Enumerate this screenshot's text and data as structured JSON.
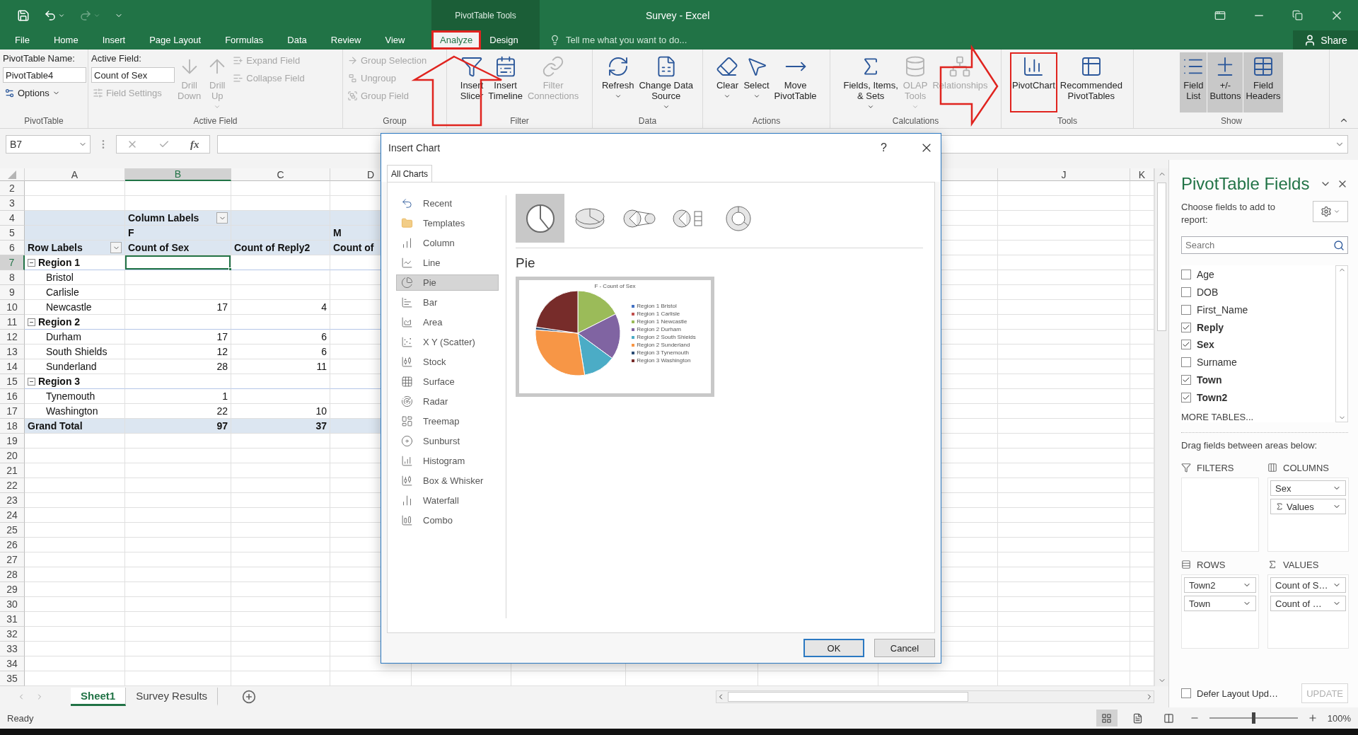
{
  "title_bar": {
    "contextual_label": "PivotTable Tools",
    "title": "Survey - Excel"
  },
  "tabs": [
    {
      "label": "File",
      "selected": false,
      "contextual": false,
      "highlighted": false
    },
    {
      "label": "Home",
      "selected": false,
      "contextual": false,
      "highlighted": false
    },
    {
      "label": "Insert",
      "selected": false,
      "contextual": false,
      "highlighted": false
    },
    {
      "label": "Page Layout",
      "selected": false,
      "contextual": false,
      "highlighted": false
    },
    {
      "label": "Formulas",
      "selected": false,
      "contextual": false,
      "highlighted": false
    },
    {
      "label": "Data",
      "selected": false,
      "contextual": false,
      "highlighted": false
    },
    {
      "label": "Review",
      "selected": false,
      "contextual": false,
      "highlighted": false
    },
    {
      "label": "View",
      "selected": false,
      "contextual": false,
      "highlighted": false
    },
    {
      "label": "Analyze",
      "selected": true,
      "contextual": true,
      "highlighted": true
    },
    {
      "label": "Design",
      "selected": false,
      "contextual": true,
      "highlighted": false
    }
  ],
  "tell_me": {
    "placeholder": "Tell me what you want to do..."
  },
  "share": "Share",
  "ribbon": {
    "groups": [
      {
        "label": "PivotTable",
        "items": [
          {
            "kind": "stack",
            "items": [
              {
                "kind": "label",
                "text": "PivotTable Name:"
              },
              {
                "kind": "field",
                "value": "PivotTable4"
              },
              {
                "kind": "small",
                "text": "Options",
                "menu": true,
                "disabled": false
              }
            ]
          }
        ]
      },
      {
        "label": "Active Field",
        "items": [
          {
            "kind": "stack",
            "items": [
              {
                "kind": "label",
                "text": "Active Field:"
              },
              {
                "kind": "field",
                "value": "Count of Sex"
              },
              {
                "kind": "small",
                "text": "Field Settings",
                "menu": false,
                "disabled": true
              }
            ]
          },
          {
            "kind": "large",
            "text": "Drill\nDown",
            "menu": false,
            "disabled": true
          },
          {
            "kind": "large",
            "text": "Drill\nUp",
            "menu": true,
            "disabled": true
          },
          {
            "kind": "stack",
            "items": [
              {
                "kind": "small",
                "text": "Expand Field",
                "menu": false,
                "disabled": true
              },
              {
                "kind": "small",
                "text": "Collapse Field",
                "menu": false,
                "disabled": true
              }
            ]
          }
        ]
      },
      {
        "label": "Group",
        "items": [
          {
            "kind": "stack",
            "items": [
              {
                "kind": "small",
                "text": "Group Selection",
                "menu": false,
                "disabled": true
              },
              {
                "kind": "small",
                "text": "Ungroup",
                "menu": false,
                "disabled": true
              },
              {
                "kind": "small",
                "text": "Group Field",
                "menu": false,
                "disabled": true
              }
            ]
          }
        ]
      },
      {
        "label": "Filter",
        "items": [
          {
            "kind": "large",
            "text": "Insert\nSlicer",
            "menu": false,
            "disabled": false
          },
          {
            "kind": "large",
            "text": "Insert\nTimeline",
            "menu": false,
            "disabled": false
          },
          {
            "kind": "large",
            "text": "Filter\nConnections",
            "menu": false,
            "disabled": true
          }
        ]
      },
      {
        "label": "Data",
        "items": [
          {
            "kind": "large",
            "text": "Refresh",
            "menu": true,
            "disabled": false
          },
          {
            "kind": "large",
            "text": "Change Data\nSource",
            "menu": true,
            "disabled": false
          }
        ]
      },
      {
        "label": "Actions",
        "items": [
          {
            "kind": "large",
            "text": "Clear",
            "menu": true,
            "disabled": false
          },
          {
            "kind": "large",
            "text": "Select",
            "menu": true,
            "disabled": false
          },
          {
            "kind": "large",
            "text": "Move\nPivotTable",
            "menu": false,
            "disabled": false
          }
        ]
      },
      {
        "label": "Calculations",
        "items": [
          {
            "kind": "large",
            "text": "Fields, Items,\n& Sets",
            "menu": true,
            "disabled": false
          },
          {
            "kind": "large",
            "text": "OLAP\nTools",
            "menu": true,
            "disabled": true
          },
          {
            "kind": "large",
            "text": "Relationships",
            "menu": false,
            "disabled": true
          }
        ]
      },
      {
        "label": "Tools",
        "items": [
          {
            "kind": "large",
            "text": "PivotChart",
            "menu": false,
            "disabled": false,
            "highlighted": true
          },
          {
            "kind": "large",
            "text": "Recommended\nPivotTables",
            "menu": false,
            "disabled": false,
            "highlighted": false
          }
        ]
      },
      {
        "label": "Show",
        "items": [
          {
            "kind": "large",
            "text": "Field\nList",
            "menu": false,
            "disabled": false,
            "on": true
          },
          {
            "kind": "large",
            "text": "+/-\nButtons",
            "menu": false,
            "disabled": false,
            "on": true
          },
          {
            "kind": "large",
            "text": "Field\nHeaders",
            "menu": false,
            "disabled": false,
            "on": true
          }
        ]
      }
    ]
  },
  "formula_bar": {
    "name_box": "B7",
    "function_label": "fx"
  },
  "sheet": {
    "columns": {
      "A": {
        "label": "A",
        "selected": false
      },
      "B": {
        "label": "B",
        "selected": true
      },
      "C": {
        "label": "C",
        "selected": false
      },
      "D": {
        "label": "D",
        "selected": false
      },
      "J": {
        "label": "J",
        "selected": false
      },
      "K": {
        "label": "K",
        "selected": false
      }
    },
    "rows": [
      {
        "number": "2",
        "selected": false,
        "kind": "blank"
      },
      {
        "number": "3",
        "selected": false,
        "kind": "blank"
      },
      {
        "number": "4",
        "selected": false,
        "kind": "band",
        "cells": {
          "B": {
            "text": "Column Labels",
            "filter": true
          }
        }
      },
      {
        "number": "5",
        "selected": false,
        "kind": "band",
        "cells": {
          "B": {
            "text": "F"
          },
          "D": {
            "text": "M"
          }
        }
      },
      {
        "number": "6",
        "selected": false,
        "kind": "band",
        "cells": {
          "A": {
            "text": "Row Labels",
            "filter": true
          },
          "B": {
            "text": "Count of Sex"
          },
          "C": {
            "text": "Count of Reply2"
          },
          "D": {
            "text": "Count of"
          }
        }
      },
      {
        "number": "7",
        "selected": true,
        "kind": "region",
        "cells": {
          "A": {
            "text": "Region 1",
            "expanded": true
          },
          "B": {
            "selected": true
          }
        }
      },
      {
        "number": "8",
        "selected": false,
        "kind": "item",
        "cells": {
          "A": {
            "text": "Bristol"
          }
        }
      },
      {
        "number": "9",
        "selected": false,
        "kind": "item",
        "cells": {
          "A": {
            "text": "Carlisle"
          }
        }
      },
      {
        "number": "10",
        "selected": false,
        "kind": "item",
        "cells": {
          "A": {
            "text": "Newcastle"
          },
          "B": {
            "text": "17"
          },
          "C": {
            "text": "4"
          }
        }
      },
      {
        "number": "11",
        "selected": false,
        "kind": "region",
        "cells": {
          "A": {
            "text": "Region 2",
            "expanded": true
          }
        }
      },
      {
        "number": "12",
        "selected": false,
        "kind": "item",
        "cells": {
          "A": {
            "text": "Durham"
          },
          "B": {
            "text": "17"
          },
          "C": {
            "text": "6"
          }
        }
      },
      {
        "number": "13",
        "selected": false,
        "kind": "item",
        "cells": {
          "A": {
            "text": "South Shields"
          },
          "B": {
            "text": "12"
          },
          "C": {
            "text": "6"
          }
        }
      },
      {
        "number": "14",
        "selected": false,
        "kind": "item",
        "cells": {
          "A": {
            "text": "Sunderland"
          },
          "B": {
            "text": "28"
          },
          "C": {
            "text": "11"
          }
        }
      },
      {
        "number": "15",
        "selected": false,
        "kind": "region",
        "cells": {
          "A": {
            "text": "Region 3",
            "expanded": true
          }
        }
      },
      {
        "number": "16",
        "selected": false,
        "kind": "item",
        "cells": {
          "A": {
            "text": "Tynemouth"
          },
          "B": {
            "text": "1"
          }
        }
      },
      {
        "number": "17",
        "selected": false,
        "kind": "item",
        "cells": {
          "A": {
            "text": "Washington"
          },
          "B": {
            "text": "22"
          },
          "C": {
            "text": "10"
          }
        }
      },
      {
        "number": "18",
        "selected": false,
        "kind": "total",
        "cells": {
          "A": {
            "text": "Grand Total"
          },
          "B": {
            "text": "97"
          },
          "C": {
            "text": "37"
          }
        }
      },
      {
        "number": "19",
        "selected": false,
        "kind": "blank"
      },
      {
        "number": "20",
        "selected": false,
        "kind": "blank"
      },
      {
        "number": "21",
        "selected": false,
        "kind": "blank"
      },
      {
        "number": "22",
        "selected": false,
        "kind": "blank"
      },
      {
        "number": "23",
        "selected": false,
        "kind": "blank"
      },
      {
        "number": "24",
        "selected": false,
        "kind": "blank"
      },
      {
        "number": "25",
        "selected": false,
        "kind": "blank"
      },
      {
        "number": "26",
        "selected": false,
        "kind": "blank"
      },
      {
        "number": "27",
        "selected": false,
        "kind": "blank"
      },
      {
        "number": "28",
        "selected": false,
        "kind": "blank"
      },
      {
        "number": "29",
        "selected": false,
        "kind": "blank"
      },
      {
        "number": "30",
        "selected": false,
        "kind": "blank"
      },
      {
        "number": "31",
        "selected": false,
        "kind": "blank"
      },
      {
        "number": "32",
        "selected": false,
        "kind": "blank"
      },
      {
        "number": "33",
        "selected": false,
        "kind": "blank"
      },
      {
        "number": "34",
        "selected": false,
        "kind": "blank"
      },
      {
        "number": "35",
        "selected": false,
        "kind": "blank"
      }
    ],
    "sheet_tabs": [
      {
        "label": "Sheet1",
        "selected": true
      },
      {
        "label": "Survey Results",
        "selected": false
      }
    ]
  },
  "status_bar": {
    "text": "Ready",
    "views": [
      {
        "selected": true
      },
      {
        "selected": false
      },
      {
        "selected": false
      }
    ],
    "zoom": {
      "level": 0.5,
      "label": "100%"
    }
  },
  "dialog": {
    "title": "Insert Chart",
    "help": "?",
    "tabs": [
      {
        "label": "All Charts",
        "selected": true
      }
    ],
    "chart_types": [
      {
        "label": "Recent",
        "selected": false
      },
      {
        "label": "Templates",
        "selected": false
      },
      {
        "label": "Column",
        "selected": false
      },
      {
        "label": "Line",
        "selected": false
      },
      {
        "label": "Pie",
        "selected": true
      },
      {
        "label": "Bar",
        "selected": false
      },
      {
        "label": "Area",
        "selected": false
      },
      {
        "label": "X Y (Scatter)",
        "selected": false
      },
      {
        "label": "Stock",
        "selected": false
      },
      {
        "label": "Surface",
        "selected": false
      },
      {
        "label": "Radar",
        "selected": false
      },
      {
        "label": "Treemap",
        "selected": false
      },
      {
        "label": "Sunburst",
        "selected": false
      },
      {
        "label": "Histogram",
        "selected": false
      },
      {
        "label": "Box & Whisker",
        "selected": false
      },
      {
        "label": "Waterfall",
        "selected": false
      },
      {
        "label": "Combo",
        "selected": false
      }
    ],
    "subtypes": [
      {
        "selected": true
      },
      {
        "selected": false
      },
      {
        "selected": false
      },
      {
        "selected": false
      },
      {
        "selected": false
      }
    ],
    "heading": "Pie",
    "preview": {
      "title": "F - Count of Sex",
      "legend": [
        {
          "label": "Region 1 Bristol",
          "color": "#4472c4"
        },
        {
          "label": "Region 1 Carlisle",
          "color": "#c0504d"
        },
        {
          "label": "Region 1 Newcastle",
          "color": "#9bbb59"
        },
        {
          "label": "Region 2 Durham",
          "color": "#8064a2"
        },
        {
          "label": "Region 2 South Shields",
          "color": "#4bacc6"
        },
        {
          "label": "Region 2 Sunderland",
          "color": "#f79646"
        },
        {
          "label": "Region 3 Tynemouth",
          "color": "#2c4d75"
        },
        {
          "label": "Region 3 Washington",
          "color": "#772c2a"
        }
      ]
    },
    "buttons": [
      {
        "label": "OK",
        "kind": "primary"
      },
      {
        "label": "Cancel",
        "kind": "secondary"
      }
    ]
  },
  "field_pane": {
    "title": "PivotTable Fields",
    "instruction": "Choose fields to add to report:",
    "search": {
      "placeholder": "Search"
    },
    "fields": [
      {
        "name": "Age",
        "checked": false
      },
      {
        "name": "DOB",
        "checked": false
      },
      {
        "name": "First_Name",
        "checked": false
      },
      {
        "name": "Reply",
        "checked": true
      },
      {
        "name": "Sex",
        "checked": true
      },
      {
        "name": "Surname",
        "checked": false
      },
      {
        "name": "Town",
        "checked": true
      },
      {
        "name": "Town2",
        "checked": true
      }
    ],
    "more_tables": "MORE TABLES...",
    "drag_hint": "Drag fields between areas below:",
    "areas": [
      {
        "kind": "filters",
        "title": "FILTERS"
      },
      {
        "kind": "columns",
        "title": "COLUMNS",
        "items": [
          {
            "label": "Sex",
            "kind": "field"
          },
          {
            "label": "Values",
            "kind": "values"
          }
        ]
      },
      {
        "kind": "rows",
        "title": "ROWS",
        "items": [
          {
            "label": "Town2",
            "kind": "field"
          },
          {
            "label": "Town",
            "kind": "field"
          }
        ]
      },
      {
        "kind": "values",
        "title": "VALUES",
        "items": [
          {
            "label": "Count of S…",
            "kind": "field"
          },
          {
            "label": "Count of …",
            "kind": "field"
          }
        ]
      }
    ],
    "defer": {
      "label": "Defer Layout Upd…",
      "checked": false
    },
    "update_button": {
      "label": "UPDATE",
      "disabled": true
    }
  },
  "annotation_arrows": [
    {
      "kind": "up"
    },
    {
      "kind": "right"
    }
  ]
}
